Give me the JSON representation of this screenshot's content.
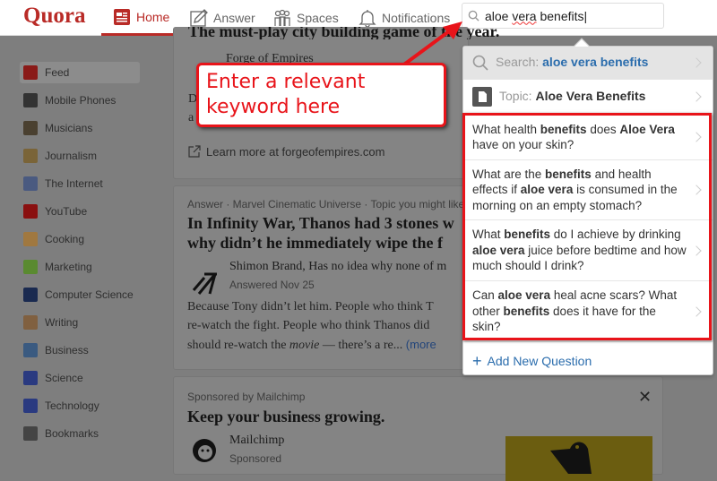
{
  "header": {
    "logo": "Quora",
    "nav": [
      {
        "label": "Home",
        "icon": "home-feed-icon",
        "active": true
      },
      {
        "label": "Answer",
        "icon": "pencil-icon"
      },
      {
        "label": "Spaces",
        "icon": "people-icon"
      },
      {
        "label": "Notifications",
        "icon": "bell-icon"
      }
    ],
    "search_value": "aloe vera benefits",
    "search_value_a": "aloe ",
    "search_value_b": "vera",
    "search_value_c": " benefits"
  },
  "sidebar": {
    "items": [
      "Feed",
      "Mobile Phones",
      "Musicians",
      "Journalism",
      "The Internet",
      "YouTube",
      "Cooking",
      "Marketing",
      "Computer Science",
      "Writing",
      "Business",
      "Science",
      "Technology",
      "Bookmarks"
    ],
    "colors": [
      "#8a1a18",
      "#333",
      "#4a4030",
      "#7a6438",
      "#4a5a80",
      "#8a1010",
      "#a07840",
      "#5a8a30",
      "#1a2a50",
      "#806040",
      "#3a5a80",
      "#2a3a80",
      "#2a3a80",
      "#444"
    ]
  },
  "ad1": {
    "title": "The must-play city building game of the year.",
    "advertiser": "Forge of Empires",
    "body_a": "D",
    "body_b": "a",
    "link": "Learn more at forgeofempires.com"
  },
  "answer": {
    "meta": "Answer · Marvel Cinematic Universe · Topic you might like",
    "title_1": "In Infinity War, Thanos had 3 stones w",
    "title_2": "why didn’t he immediately wipe the f",
    "author": "Shimon Brand, Has no idea why none of m",
    "date": "Answered Nov 25",
    "body_1": "Because Tony didn’t let him. People who think T",
    "body_2": "re-watch the fight. People who think Thanos did",
    "body_3a": "should re-watch the ",
    "body_3b": "movie",
    "body_3c": " — there’s a re... ",
    "more": "(more"
  },
  "ad2": {
    "meta": "Sponsored by Mailchimp",
    "title": "Keep your business growing.",
    "advertiser": "Mailchimp",
    "sub": "Sponsored"
  },
  "dropdown": {
    "search_label": "Search: ",
    "search_term": "aloe vera benefits",
    "topic_label": "Topic: ",
    "topic_name": "Aloe Vera Benefits",
    "questions": [
      [
        [
          "What health ",
          0
        ],
        [
          "benefits",
          1
        ],
        [
          " does ",
          0
        ],
        [
          "Aloe Vera",
          1
        ],
        [
          " have on your skin?",
          0
        ]
      ],
      [
        [
          "What are the ",
          0
        ],
        [
          "benefits",
          1
        ],
        [
          " and health effects if ",
          0
        ],
        [
          "aloe vera",
          1
        ],
        [
          " is consumed in the morning on an empty stomach?",
          0
        ]
      ],
      [
        [
          "What ",
          0
        ],
        [
          "benefits",
          1
        ],
        [
          " do I achieve by drinking ",
          0
        ],
        [
          "aloe vera",
          1
        ],
        [
          " juice before bedtime and how much should I drink?",
          0
        ]
      ],
      [
        [
          "Can ",
          0
        ],
        [
          "aloe vera",
          1
        ],
        [
          " heal acne scars? What other ",
          0
        ],
        [
          "benefits",
          1
        ],
        [
          " does it have for the skin?",
          0
        ]
      ]
    ],
    "add_question": "Add New Question",
    "accent": "#2b6dad"
  },
  "annotation": {
    "text": "Enter a relevant keyword here",
    "color": "#e8141a"
  }
}
